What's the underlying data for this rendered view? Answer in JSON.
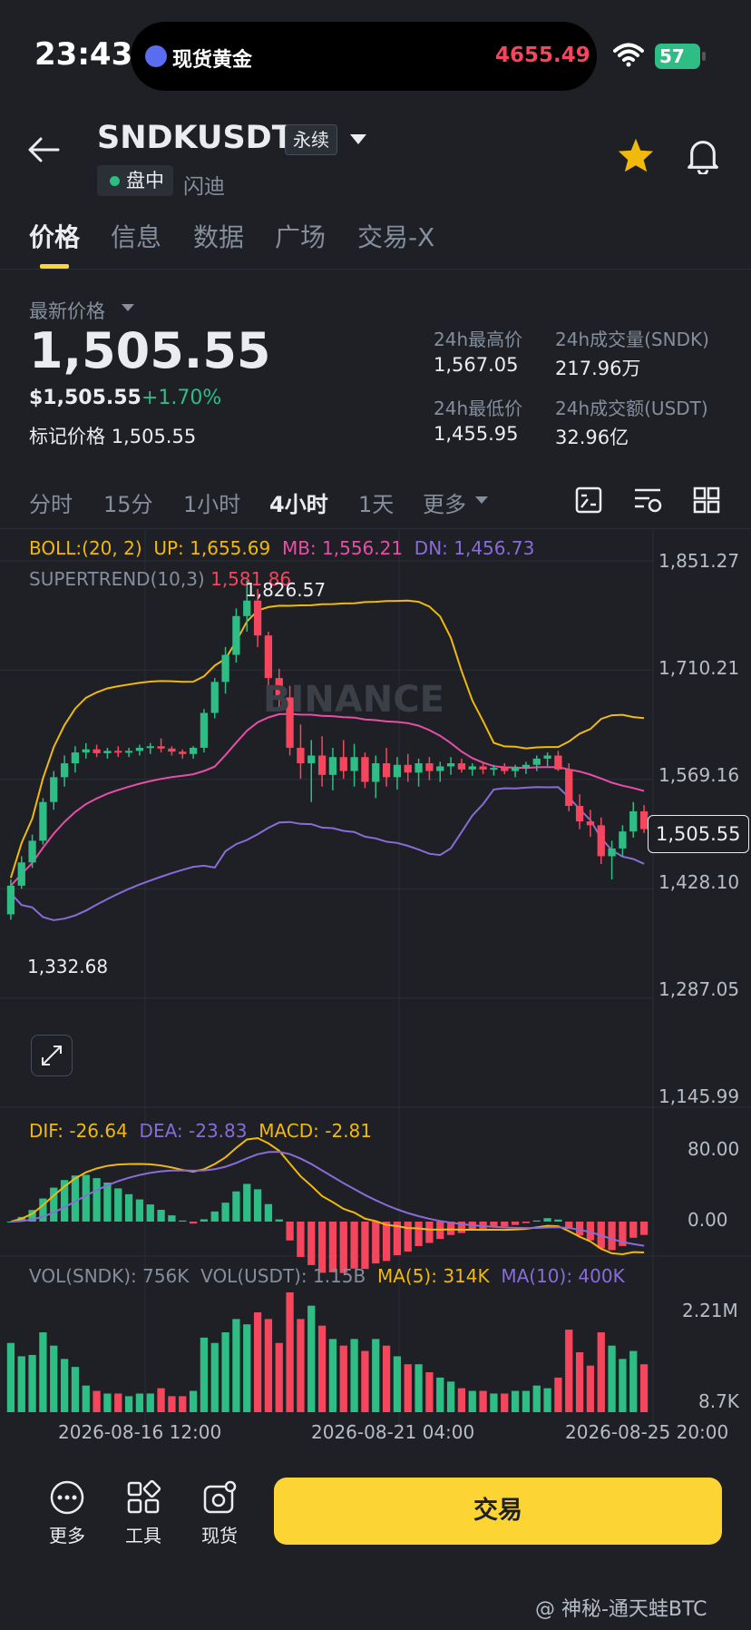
{
  "status_bar": {
    "time": "23:43",
    "island_title": "现货黄金",
    "island_price": "4655.49",
    "battery": "57"
  },
  "header": {
    "pair": "SNDKUSDT",
    "contract_type": "永续",
    "session": "盘中",
    "flash": "闪迪",
    "favorited": true,
    "icons": [
      "back-arrow-icon",
      "star-icon",
      "bell-icon"
    ]
  },
  "tabs": [
    {
      "label": "价格",
      "active": true
    },
    {
      "label": "信息"
    },
    {
      "label": "数据"
    },
    {
      "label": "广场"
    },
    {
      "label": "交易-X"
    }
  ],
  "price": {
    "label": "最新价格",
    "last": "1,505.55",
    "usd": "$1,505.55",
    "change": "+1.70%",
    "mark_label": "标记价格",
    "mark_value": "1,505.55",
    "high_label": "24h最高价",
    "high": "1,567.05",
    "low_label": "24h最低价",
    "low": "1,455.95",
    "vol_base_label": "24h成交量(SNDK)",
    "vol_base": "217.96万",
    "vol_quote_label": "24h成交额(USDT)",
    "vol_quote": "32.96亿"
  },
  "timeframes": [
    "分时",
    "15分",
    "1小时",
    "4小时",
    "1天",
    "更多"
  ],
  "active_timeframe": "4小时",
  "colors": {
    "up": "#2ebd85",
    "down": "#f6465d",
    "accent": "#fcd535",
    "bg": "#1e2026",
    "boll_up": "#f0b90b",
    "boll_mb": "#e84ea8",
    "boll_dn": "#8a6cd8"
  },
  "chart_data": [
    {
      "type": "candlestick",
      "legend": {
        "boll": "BOLL:(20, 2)",
        "up": "UP: 1,655.69",
        "mb": "MB: 1,556.21",
        "dn": "DN: 1,456.73",
        "supertrend": "SUPERTREND(10,3)",
        "supertrend_val": "1,581.86"
      },
      "y_ticks": [
        "1,851.27",
        "1,710.21",
        "1,569.16",
        "1,428.10",
        "1,287.05",
        "1,145.99"
      ],
      "ylim": [
        1145.99,
        1851.27
      ],
      "last_price_tag": "1,505.55",
      "annotations": {
        "high": "1,826.57",
        "low": "1,332.68"
      },
      "watermark": "BINANCE",
      "x_ticks": [
        "2026-08-16 12:00",
        "2026-08-21 04:00",
        "2026-08-25 20:00"
      ],
      "candles": [
        [
          1395,
          1440,
          1388,
          1432
        ],
        [
          1432,
          1470,
          1428,
          1462
        ],
        [
          1462,
          1498,
          1455,
          1490
        ],
        [
          1490,
          1545,
          1485,
          1540
        ],
        [
          1540,
          1580,
          1530,
          1572
        ],
        [
          1572,
          1600,
          1560,
          1590
        ],
        [
          1590,
          1612,
          1578,
          1604
        ],
        [
          1604,
          1616,
          1596,
          1608
        ],
        [
          1608,
          1614,
          1598,
          1603
        ],
        [
          1603,
          1610,
          1596,
          1606
        ],
        [
          1606,
          1612,
          1598,
          1604
        ],
        [
          1604,
          1610,
          1598,
          1606
        ],
        [
          1606,
          1614,
          1600,
          1610
        ],
        [
          1610,
          1616,
          1602,
          1612
        ],
        [
          1612,
          1622,
          1604,
          1609
        ],
        [
          1609,
          1612,
          1600,
          1605
        ],
        [
          1605,
          1608,
          1596,
          1602
        ],
        [
          1602,
          1612,
          1596,
          1610
        ],
        [
          1610,
          1660,
          1604,
          1655
        ],
        [
          1655,
          1700,
          1648,
          1695
        ],
        [
          1695,
          1740,
          1680,
          1730
        ],
        [
          1730,
          1790,
          1720,
          1780
        ],
        [
          1780,
          1826,
          1760,
          1800
        ],
        [
          1800,
          1815,
          1740,
          1755
        ],
        [
          1755,
          1760,
          1690,
          1700
        ],
        [
          1700,
          1712,
          1660,
          1675
        ],
        [
          1675,
          1690,
          1600,
          1610
        ],
        [
          1610,
          1640,
          1570,
          1590
        ],
        [
          1590,
          1620,
          1540,
          1600
        ],
        [
          1600,
          1625,
          1560,
          1575
        ],
        [
          1575,
          1610,
          1555,
          1598
        ],
        [
          1598,
          1620,
          1570,
          1580
        ],
        [
          1580,
          1615,
          1560,
          1598
        ],
        [
          1598,
          1604,
          1558,
          1566
        ],
        [
          1566,
          1600,
          1545,
          1590
        ],
        [
          1590,
          1610,
          1560,
          1572
        ],
        [
          1572,
          1598,
          1556,
          1588
        ],
        [
          1588,
          1602,
          1566,
          1578
        ],
        [
          1578,
          1596,
          1560,
          1590
        ],
        [
          1590,
          1598,
          1568,
          1580
        ],
        [
          1580,
          1592,
          1566,
          1586
        ],
        [
          1586,
          1598,
          1575,
          1590
        ],
        [
          1590,
          1596,
          1578,
          1582
        ],
        [
          1582,
          1590,
          1574,
          1586
        ],
        [
          1586,
          1592,
          1576,
          1582
        ],
        [
          1582,
          1588,
          1574,
          1584
        ],
        [
          1584,
          1590,
          1576,
          1580
        ],
        [
          1580,
          1588,
          1572,
          1584
        ],
        [
          1584,
          1592,
          1576,
          1588
        ],
        [
          1588,
          1600,
          1580,
          1596
        ],
        [
          1596,
          1604,
          1586,
          1600
        ],
        [
          1600,
          1606,
          1580,
          1582
        ],
        [
          1582,
          1590,
          1528,
          1535
        ],
        [
          1535,
          1550,
          1505,
          1515
        ],
        [
          1515,
          1530,
          1495,
          1510
        ],
        [
          1510,
          1520,
          1460,
          1470
        ],
        [
          1470,
          1490,
          1440,
          1480
        ],
        [
          1480,
          1510,
          1470,
          1502
        ],
        [
          1502,
          1540,
          1494,
          1528
        ],
        [
          1528,
          1536,
          1500,
          1505
        ]
      ]
    },
    {
      "type": "bar",
      "name": "MACD",
      "legend": {
        "dif": "DIF: -26.64",
        "dea": "DEA: -23.83",
        "macd": "MACD: -2.81"
      },
      "y_ticks": [
        "80.00",
        "0.00"
      ]
    },
    {
      "type": "bar",
      "name": "VOL",
      "legend": {
        "vol_base": "VOL(SNDK): 756K",
        "vol_quote": "VOL(USDT): 1.15B",
        "ma5": "MA(5): 314K",
        "ma10": "MA(10): 400K"
      },
      "y_ticks": [
        "2.21M",
        "8.7K"
      ]
    }
  ],
  "bottom_bar": {
    "more": "更多",
    "tools": "工具",
    "spot": "现货",
    "trade": "交易"
  },
  "watermark": "@ 神秘-通天蛙BTC"
}
